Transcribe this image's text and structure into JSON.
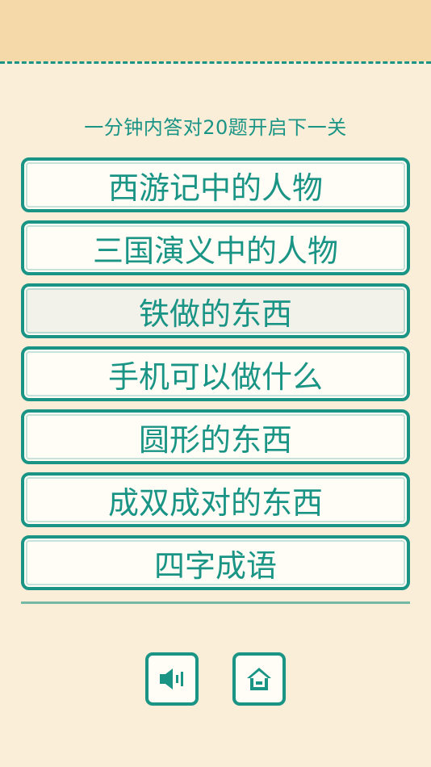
{
  "header": {
    "hint": "一分钟内答对20题开启下一关"
  },
  "categories": [
    {
      "label": "西游记中的人物"
    },
    {
      "label": "三国演义中的人物"
    },
    {
      "label": "铁做的东西"
    },
    {
      "label": "手机可以做什么"
    },
    {
      "label": "圆形的东西"
    },
    {
      "label": "成双成对的东西"
    },
    {
      "label": "四字成语"
    }
  ],
  "selected_index": 2,
  "controls": {
    "sound_icon": "speaker-icon",
    "home_icon": "home-icon"
  },
  "colors": {
    "accent": "#1a9485",
    "background": "#fbeed8",
    "header": "#f5d9a8"
  }
}
